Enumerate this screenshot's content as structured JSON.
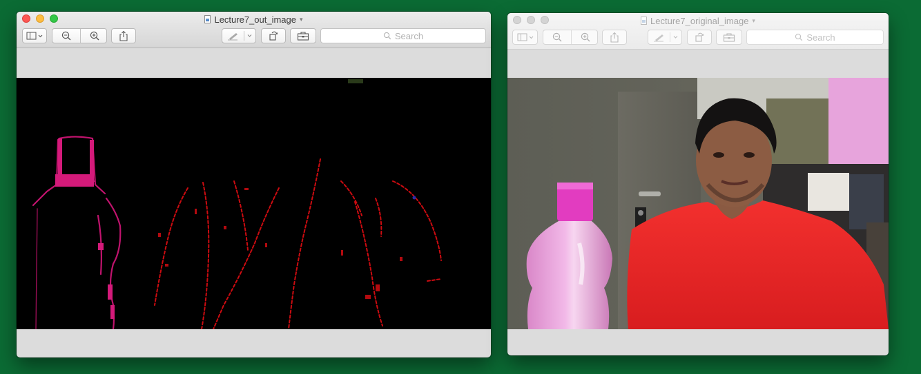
{
  "windows": {
    "left": {
      "title": "Lecture7_out_image",
      "search_placeholder": "Search",
      "state": "active"
    },
    "right": {
      "title": "Lecture7_original_image",
      "search_placeholder": "Search",
      "state": "inactive"
    }
  },
  "icons": {
    "sidebar": "sidebar-toggle-icon",
    "zoom_out": "zoom-out-icon",
    "zoom_in": "zoom-in-icon",
    "share": "share-icon",
    "markup": "pen-icon",
    "rotate": "rotate-icon",
    "toolbox": "toolbox-icon",
    "search": "search-icon"
  },
  "colors": {
    "desktop": "#0b6b34",
    "close": "#fc5753",
    "minimize": "#fdbc40",
    "zoom": "#33c748"
  }
}
